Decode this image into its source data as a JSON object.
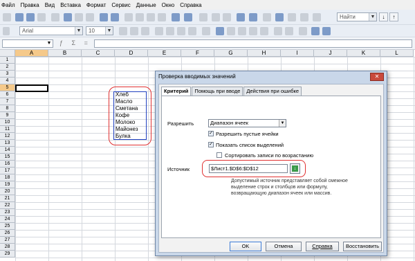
{
  "menu": [
    "Файл",
    "Правка",
    "Вид",
    "Вставка",
    "Формат",
    "Сервис",
    "Данные",
    "Окно",
    "Справка"
  ],
  "toolbar": {
    "find_placeholder": "Найти",
    "font_name": "Arial",
    "font_size": "10"
  },
  "sheet": {
    "columns": [
      "A",
      "B",
      "C",
      "D",
      "E",
      "F",
      "G",
      "H",
      "I",
      "J",
      "K",
      "L"
    ],
    "rows": [
      "1",
      "2",
      "3",
      "4",
      "5",
      "6",
      "7",
      "8",
      "9",
      "10",
      "11",
      "12",
      "13",
      "14",
      "15",
      "16",
      "17",
      "18",
      "19",
      "20",
      "21",
      "22",
      "23",
      "24",
      "25",
      "26",
      "27",
      "28",
      "29"
    ],
    "selected_column": "A",
    "selected_row": "5",
    "d_values": [
      "Хлеб",
      "Масло",
      "Сметана",
      "Кофе",
      "Молоко",
      "Майонез",
      "Булка"
    ]
  },
  "dialog": {
    "title": "Проверка вводимых значений",
    "close": "✕",
    "tabs": [
      "Критерий",
      "Помощь при вводе",
      "Действия при ошибке"
    ],
    "allow_label": "Разрешить",
    "allow_value": "Диапазон ячеек",
    "allow_empty": "Разрешить пустые ячейки",
    "show_list": "Показать список выделений",
    "sort_asc": "Сортировать записи по возрастанию",
    "source_label": "Источник",
    "source_value": "$Лист1.$D$6:$D$12",
    "hint": "Допустимый источник представляет собой смежное выделение строк и столбцов или формулу, возвращающую диапазон ячеек или массив.",
    "buttons": [
      "OK",
      "Отмена",
      "Справка",
      "Восстановить"
    ]
  }
}
